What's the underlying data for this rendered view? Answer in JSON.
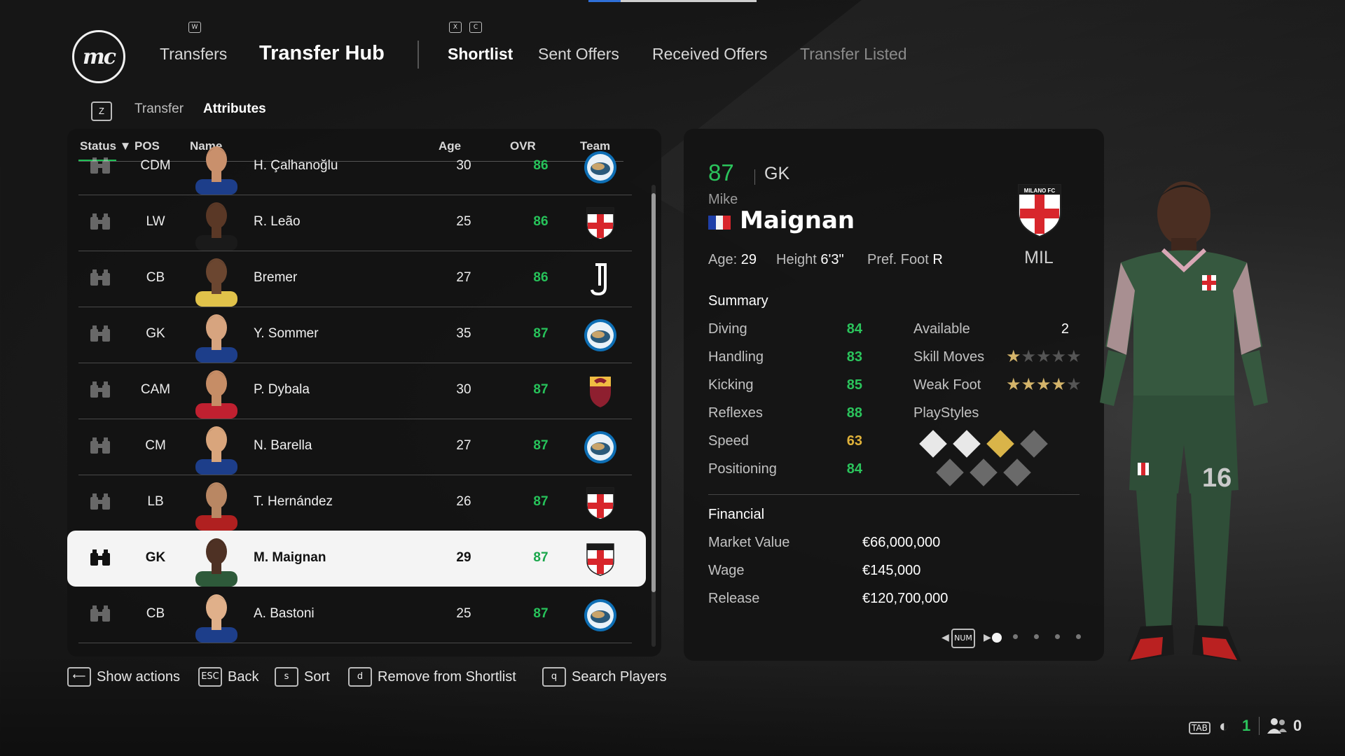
{
  "header": {
    "logo_text": "mc",
    "hints": {
      "w": "W",
      "x": "X",
      "c": "C"
    },
    "nav": {
      "transfers": "Transfers",
      "hub": "Transfer Hub",
      "shortlist": "Shortlist",
      "sent": "Sent Offers",
      "received": "Received Offers",
      "listed": "Transfer Listed"
    },
    "subtab_key": "Z",
    "subtabs": {
      "transfer": "Transfer",
      "attributes": "Attributes"
    }
  },
  "table": {
    "headers": {
      "status": "Status ▼",
      "pos": "POS",
      "name": "Name",
      "age": "Age",
      "ovr": "OVR",
      "team": "Team"
    },
    "rows": [
      {
        "pos": "CDM",
        "name": "H. Çalhanoğlu",
        "age": "30",
        "ovr": "86",
        "team_icon": "inter-crest-icon"
      },
      {
        "pos": "LW",
        "name": "R. Leão",
        "age": "25",
        "ovr": "86",
        "team_icon": "milano-fc-crest-icon"
      },
      {
        "pos": "CB",
        "name": "Bremer",
        "age": "27",
        "ovr": "86",
        "team_icon": "juventus-logo-icon"
      },
      {
        "pos": "GK",
        "name": "Y. Sommer",
        "age": "35",
        "ovr": "87",
        "team_icon": "inter-crest-icon"
      },
      {
        "pos": "CAM",
        "name": "P. Dybala",
        "age": "30",
        "ovr": "87",
        "team_icon": "roma-crest-icon"
      },
      {
        "pos": "CM",
        "name": "N. Barella",
        "age": "27",
        "ovr": "87",
        "team_icon": "inter-crest-icon"
      },
      {
        "pos": "LB",
        "name": "T. Hernández",
        "age": "26",
        "ovr": "87",
        "team_icon": "milano-fc-crest-icon"
      },
      {
        "pos": "GK",
        "name": "M. Maignan",
        "age": "29",
        "ovr": "87",
        "team_icon": "milano-fc-crest-icon",
        "selected": true
      },
      {
        "pos": "CB",
        "name": "A. Bastoni",
        "age": "25",
        "ovr": "87",
        "team_icon": "inter-crest-icon"
      }
    ]
  },
  "actions": {
    "show": {
      "key": "⟵",
      "label": "Show actions"
    },
    "back": {
      "key": "ESC",
      "label": "Back"
    },
    "sort": {
      "key": "s",
      "label": "Sort"
    },
    "remove": {
      "key": "d",
      "label": "Remove from Shortlist"
    },
    "search": {
      "key": "q",
      "label": "Search Players"
    }
  },
  "player": {
    "ovr": "87",
    "pos": "GK",
    "first_name": "Mike",
    "last_name": "Maignan",
    "nation_flag": "france-flag-icon",
    "club_crest_text": "MILANO FC",
    "club_short": "MIL",
    "age_label": "Age:",
    "age": "29",
    "height_label": "Height",
    "height": "6'3\"",
    "foot_label": "Pref. Foot",
    "foot": "R",
    "summary_title": "Summary",
    "attributes": [
      {
        "label": "Diving",
        "value": "84",
        "color": "#2bc45c"
      },
      {
        "label": "Handling",
        "value": "83",
        "color": "#2bc45c"
      },
      {
        "label": "Kicking",
        "value": "85",
        "color": "#2bc45c"
      },
      {
        "label": "Reflexes",
        "value": "88",
        "color": "#2bc45c"
      },
      {
        "label": "Speed",
        "value": "63",
        "color": "#e0b23a"
      },
      {
        "label": "Positioning",
        "value": "84",
        "color": "#2bc45c"
      }
    ],
    "available_label": "Available",
    "available": "2",
    "skill_moves_label": "Skill Moves",
    "skill_moves": 1,
    "weak_foot_label": "Weak Foot",
    "weak_foot": 4,
    "stars_max": 5,
    "playstyles_label": "PlayStyles",
    "financial_title": "Financial",
    "financial": [
      {
        "label": "Market Value",
        "value": "€66,000,000"
      },
      {
        "label": "Wage",
        "value": "€145,000"
      },
      {
        "label": "Release",
        "value": "€120,700,000"
      }
    ],
    "pager_key": "NUM",
    "pages": 5,
    "current_page": 1,
    "shirt_number": "16"
  },
  "status_bar": {
    "tab_key": "TAB",
    "count_a": "1",
    "count_b": "0",
    "accent": "#2bc45c"
  }
}
